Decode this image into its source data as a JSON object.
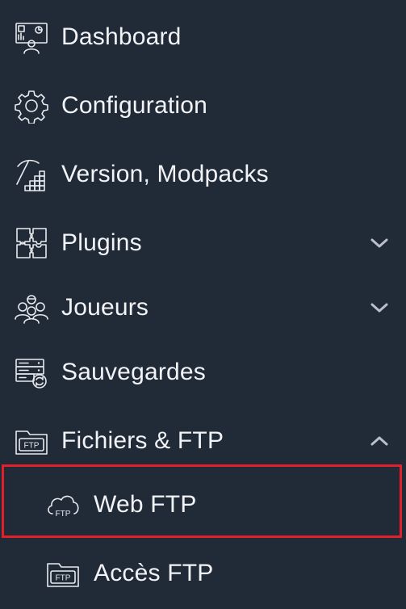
{
  "menu": {
    "items": [
      {
        "label": "Dashboard",
        "icon": "dashboard-icon"
      },
      {
        "label": "Configuration",
        "icon": "gear-icon"
      },
      {
        "label": "Version, Modpacks",
        "icon": "pickaxe-blocks-icon"
      },
      {
        "label": "Plugins",
        "icon": "puzzle-icon",
        "chevron": "chevron-down-icon"
      },
      {
        "label": "Joueurs",
        "icon": "players-icon",
        "chevron": "chevron-down-icon"
      },
      {
        "label": "Sauvegardes",
        "icon": "server-backup-icon"
      },
      {
        "label": "Fichiers & FTP",
        "icon": "ftp-folder-icon",
        "chevron": "chevron-up-icon"
      }
    ],
    "subitems": [
      {
        "label": "Web FTP",
        "icon": "cloud-ftp-icon",
        "ftp_tag": "FTP",
        "selected": true
      },
      {
        "label": "Accès FTP",
        "icon": "ftp-folder-icon",
        "ftp_tag": "FTP"
      }
    ],
    "folder_tag": "FTP"
  },
  "colors": {
    "background": "#212a37",
    "text": "#f1f3f6",
    "highlight_border": "#e0202a"
  }
}
